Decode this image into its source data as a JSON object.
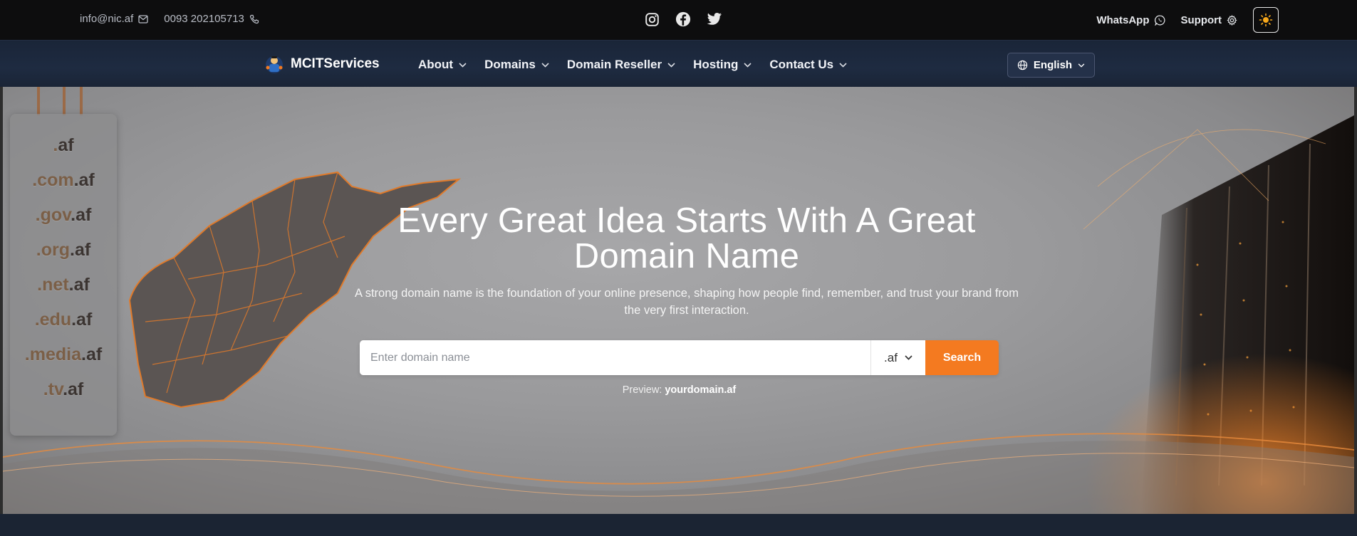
{
  "topbar": {
    "email": "info@nic.af",
    "phone": "0093 202105713",
    "social": [
      "instagram-icon",
      "facebook-icon",
      "twitter-icon"
    ],
    "whatsapp_label": "WhatsApp",
    "support_label": "Support"
  },
  "nav": {
    "brand": "MCITServices",
    "items": [
      {
        "label": "About"
      },
      {
        "label": "Domains"
      },
      {
        "label": "Domain Reseller"
      },
      {
        "label": "Hosting"
      },
      {
        "label": "Contact Us"
      }
    ],
    "language": "English"
  },
  "tlds": [
    {
      "pre": ".",
      "suf": "af"
    },
    {
      "pre": ".com",
      "suf": ".af"
    },
    {
      "pre": ".gov",
      "suf": ".af"
    },
    {
      "pre": ".org",
      "suf": ".af"
    },
    {
      "pre": ".net",
      "suf": ".af"
    },
    {
      "pre": ".edu",
      "suf": ".af"
    },
    {
      "pre": ".media",
      "suf": ".af"
    },
    {
      "pre": ".tv",
      "suf": ".af"
    }
  ],
  "hero": {
    "title_line1": "Every Great Idea Starts With A Great",
    "title_line2": "Domain Name",
    "subtitle": "A strong domain name is the foundation of your online presence, shaping how people find, remember, and trust your brand from the very first interaction.",
    "search_placeholder": "Enter domain name",
    "selected_tld": ".af",
    "search_button": "Search",
    "preview_label": "Preview:",
    "preview_value": "yourdomain.af"
  },
  "colors": {
    "accent": "#f47a20",
    "topbar": "#0d0d0e",
    "navbar": "#1e2b41"
  }
}
